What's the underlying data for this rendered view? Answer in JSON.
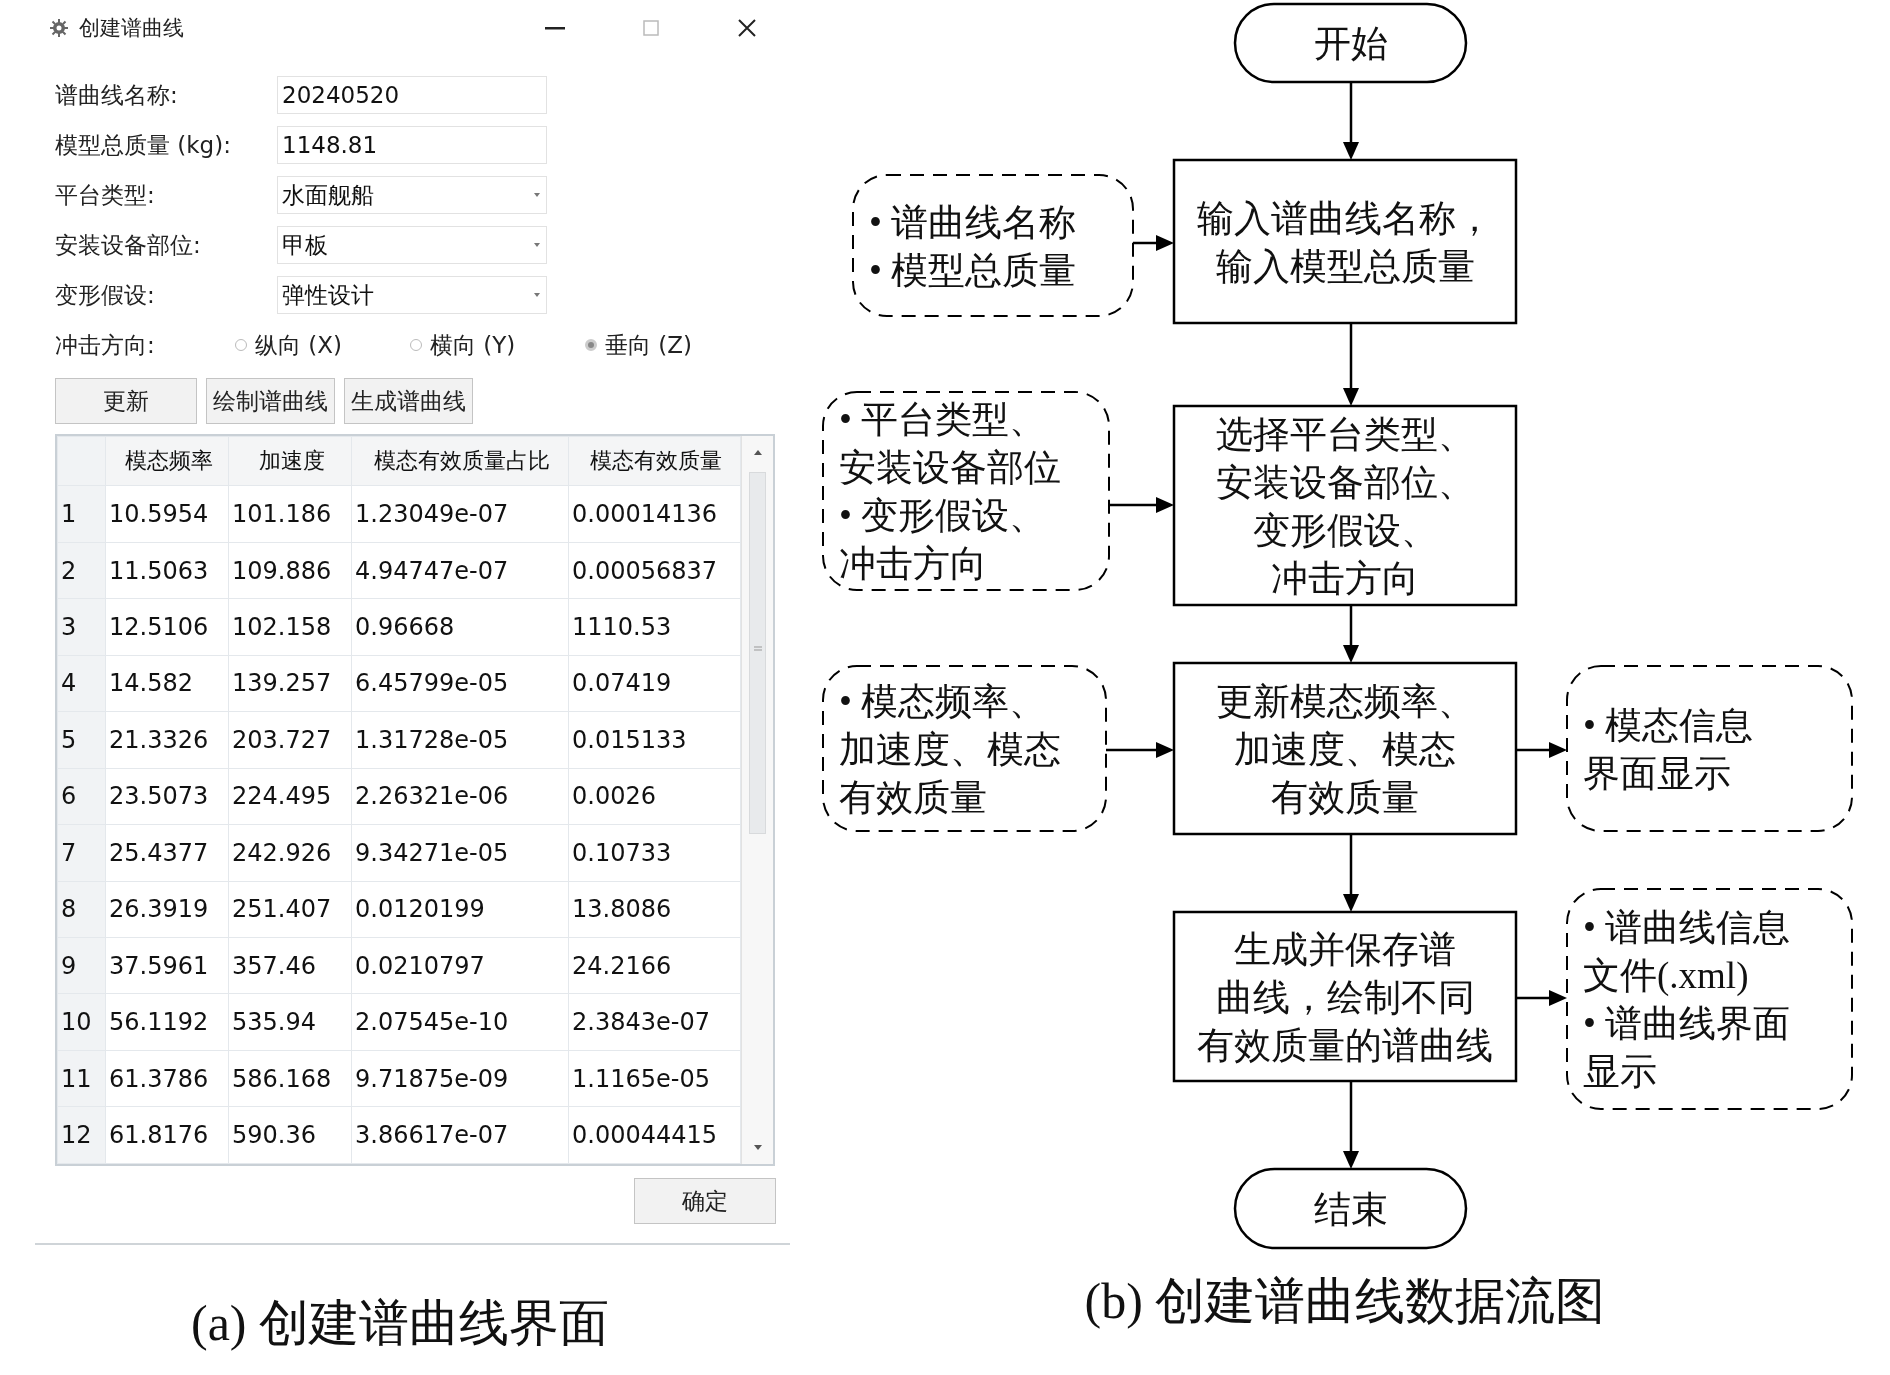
{
  "window": {
    "title": "创建谱曲线"
  },
  "form": {
    "fields": [
      {
        "kind": "text",
        "label": "谱曲线名称:",
        "value": "20240520"
      },
      {
        "kind": "text",
        "label": "模型总质量 (kg):",
        "value": "1148.81"
      },
      {
        "kind": "dropdown",
        "label": "平台类型:",
        "value": "水面舰船"
      },
      {
        "kind": "dropdown",
        "label": "安装设备部位:",
        "value": "甲板"
      },
      {
        "kind": "dropdown",
        "label": "变形假设:",
        "value": "弹性设计"
      }
    ]
  },
  "impact_direction": {
    "label": "冲击方向:",
    "options": [
      {
        "label": "纵向 (X)",
        "selected": false
      },
      {
        "label": "横向 (Y)",
        "selected": false
      },
      {
        "label": "垂向 (Z)",
        "selected": true
      }
    ]
  },
  "buttons": [
    "更新",
    "绘制谱曲线",
    "生成谱曲线"
  ],
  "table": {
    "columns": [
      "模态频率",
      "加速度",
      "模态有效质量占比",
      "模态有效质量"
    ],
    "rows": [
      {
        "number": "1",
        "cells": [
          "10.5954",
          "101.186",
          "1.23049e-07",
          "0.00014136"
        ]
      },
      {
        "number": "2",
        "cells": [
          "11.5063",
          "109.886",
          "4.94747e-07",
          "0.00056837"
        ]
      },
      {
        "number": "3",
        "cells": [
          "12.5106",
          "102.158",
          "0.96668",
          "1110.53"
        ]
      },
      {
        "number": "4",
        "cells": [
          "14.582",
          "139.257",
          "6.45799e-05",
          "0.07419"
        ]
      },
      {
        "number": "5",
        "cells": [
          "21.3326",
          "203.727",
          "1.31728e-05",
          "0.015133"
        ]
      },
      {
        "number": "6",
        "cells": [
          "23.5073",
          "224.495",
          "2.26321e-06",
          "0.0026"
        ]
      },
      {
        "number": "7",
        "cells": [
          "25.4377",
          "242.926",
          "9.34271e-05",
          "0.10733"
        ]
      },
      {
        "number": "8",
        "cells": [
          "26.3919",
          "251.407",
          "0.0120199",
          "13.8086"
        ]
      },
      {
        "number": "9",
        "cells": [
          "37.5961",
          "357.46",
          "0.0210797",
          "24.2166"
        ]
      },
      {
        "number": "10",
        "cells": [
          "56.1192",
          "535.94",
          "2.07545e-10",
          "2.3843e-07"
        ]
      },
      {
        "number": "11",
        "cells": [
          "61.3786",
          "586.168",
          "9.71875e-09",
          "1.1165e-05"
        ]
      },
      {
        "number": "12",
        "cells": [
          "61.8176",
          "590.36",
          "3.86617e-07",
          "0.00044415"
        ]
      }
    ]
  },
  "ok_button": "确定",
  "caption_a": "(a) 创建谱曲线界面",
  "flowchart": {
    "nodes": [
      {
        "kind": "terminal",
        "lines": [
          "开始"
        ]
      },
      {
        "kind": "data",
        "lines": [
          "• 谱曲线名称",
          "• 模型总质量"
        ]
      },
      {
        "kind": "process",
        "lines": [
          "输入谱曲线名称，",
          "输入模型总质量"
        ]
      },
      {
        "kind": "data",
        "lines": [
          "• 平台类型、",
          "安装设备部位",
          "• 变形假设、",
          "冲击方向"
        ]
      },
      {
        "kind": "process",
        "lines": [
          "选择平台类型、",
          "安装设备部位、",
          "变形假设、",
          "冲击方向"
        ]
      },
      {
        "kind": "data",
        "lines": [
          "• 模态频率、",
          "加速度、模态",
          "有效质量"
        ]
      },
      {
        "kind": "process",
        "lines": [
          "更新模态频率、",
          "加速度、模态",
          "有效质量"
        ]
      },
      {
        "kind": "data",
        "lines": [
          "• 模态信息",
          "界面显示"
        ]
      },
      {
        "kind": "process",
        "lines": [
          "生成并保存谱",
          "曲线，绘制不同",
          "有效质量的谱曲线"
        ]
      },
      {
        "kind": "data",
        "lines": [
          "• 谱曲线信息",
          "文件(.xml)",
          "• 谱曲线界面",
          "显示"
        ]
      },
      {
        "kind": "terminal",
        "lines": [
          "结束"
        ]
      }
    ]
  },
  "caption_b": "(b) 创建谱曲线数据流图"
}
